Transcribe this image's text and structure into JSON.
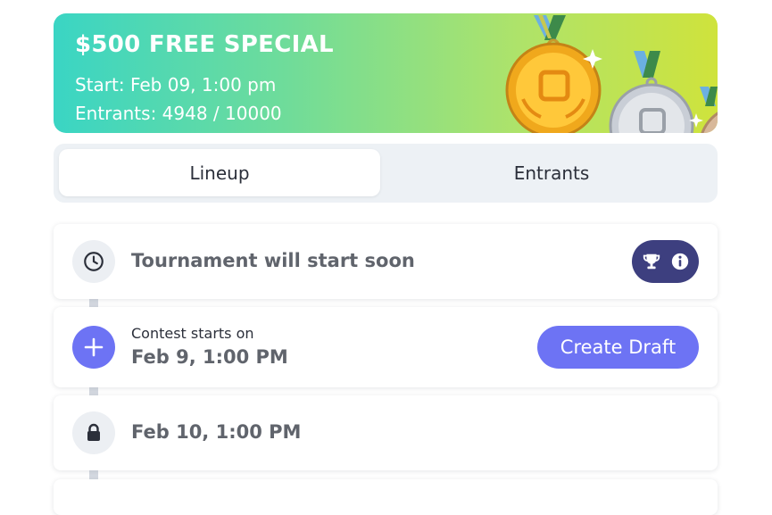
{
  "banner": {
    "title": "$500 FREE SPECIAL",
    "start": "Start: Feb 09, 1:00 pm",
    "entrants": "Entrants: 4948 / 10000"
  },
  "tabs": {
    "lineup": "Lineup",
    "entrants": "Entrants"
  },
  "status": {
    "text": "Tournament will start soon"
  },
  "contest": {
    "label": "Contest starts on",
    "date": "Feb 9, 1:00 PM",
    "button": "Create Draft"
  },
  "lock": {
    "date": "Feb 10, 1:00 PM"
  },
  "icons": [
    "clock-icon",
    "trophy-icon",
    "info-icon",
    "plus-icon",
    "lock-icon",
    "gold-medal-icon",
    "silver-medal-icon",
    "bronze-medal-icon"
  ],
  "colors": {
    "accent": "#6d73f4",
    "pill": "#3d3f7f",
    "banner_start": "#3ad5c4",
    "banner_end": "#cfe33c"
  }
}
